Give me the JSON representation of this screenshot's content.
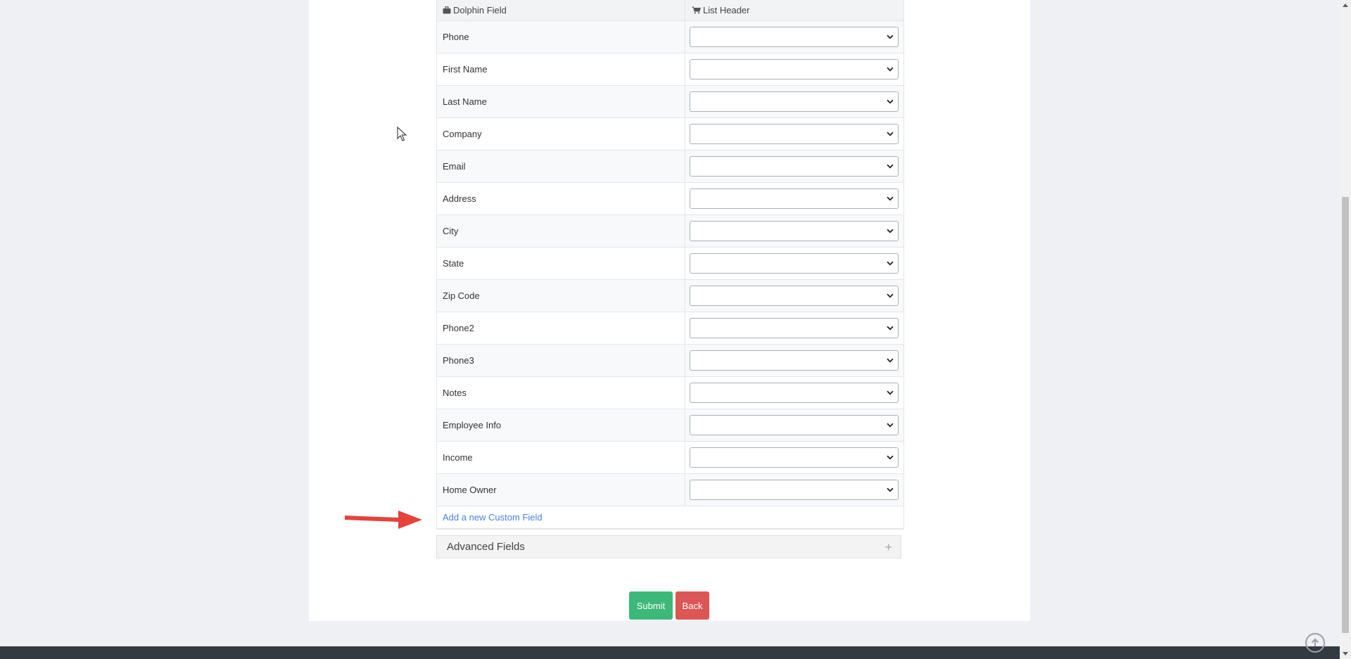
{
  "table": {
    "header_col1": "Dolphin Field",
    "header_col2": "List Header",
    "header_col1_icon": "briefcase-icon",
    "header_col2_icon": "cart-icon",
    "rows": [
      {
        "label": "Phone",
        "value": ""
      },
      {
        "label": "First Name",
        "value": ""
      },
      {
        "label": "Last Name",
        "value": ""
      },
      {
        "label": "Company",
        "value": ""
      },
      {
        "label": "Email",
        "value": ""
      },
      {
        "label": "Address",
        "value": ""
      },
      {
        "label": "City",
        "value": ""
      },
      {
        "label": "State",
        "value": ""
      },
      {
        "label": "Zip Code",
        "value": ""
      },
      {
        "label": "Phone2",
        "value": ""
      },
      {
        "label": "Phone3",
        "value": ""
      },
      {
        "label": "Notes",
        "value": ""
      },
      {
        "label": "Employee Info",
        "value": ""
      },
      {
        "label": "Income",
        "value": ""
      },
      {
        "label": "Home Owner",
        "value": ""
      }
    ],
    "add_custom_field": "Add a new Custom Field"
  },
  "advanced": {
    "title": "Advanced Fields",
    "toggle_icon": "plus-icon"
  },
  "buttons": {
    "submit": "Submit",
    "back": "Back"
  },
  "colors": {
    "submit": "#3cb878",
    "back": "#dc5656",
    "link": "#4e7ee0",
    "annotation_arrow": "#e5423b",
    "footer": "#343a42"
  }
}
